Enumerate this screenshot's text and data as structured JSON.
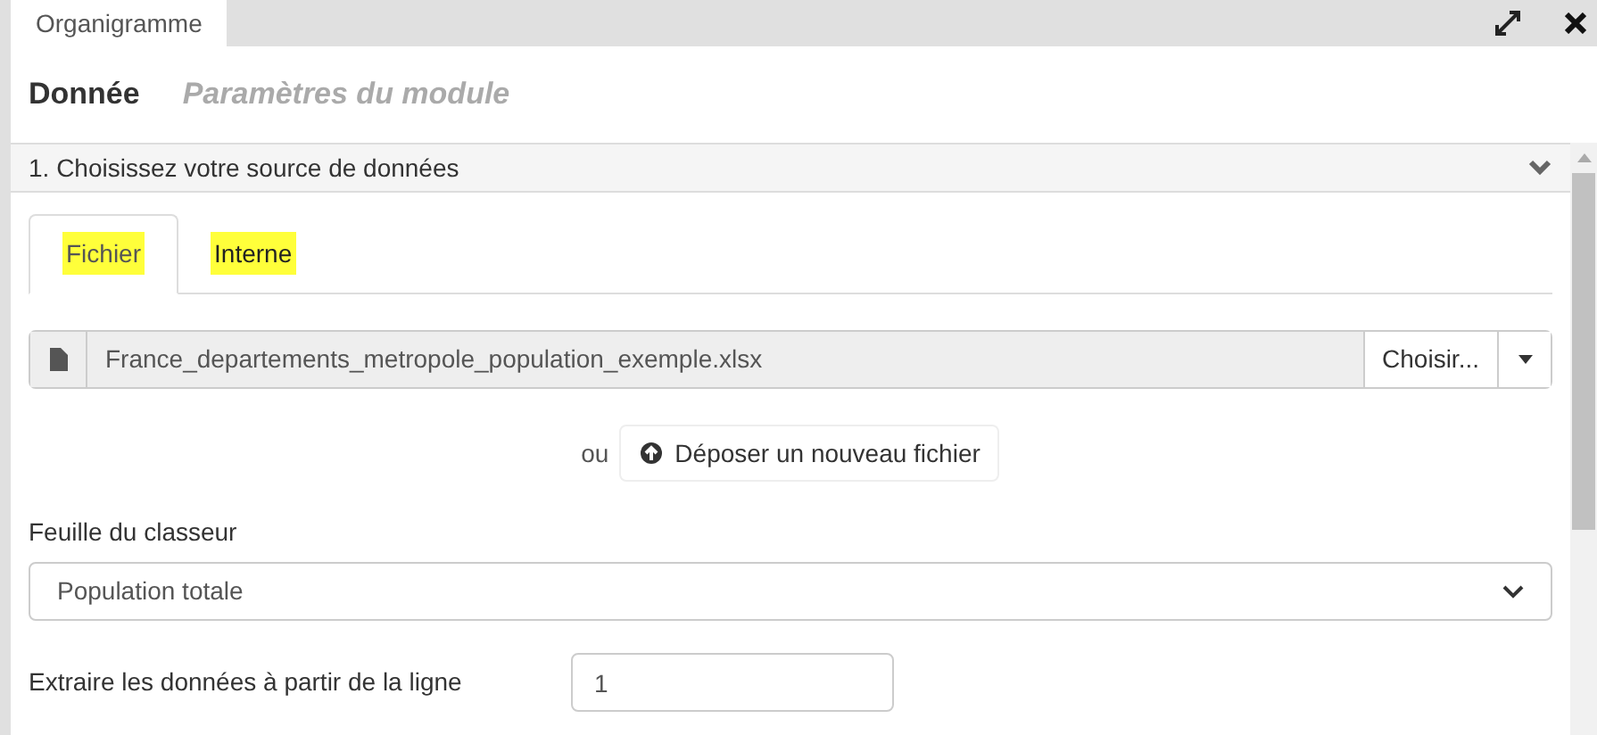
{
  "window": {
    "tab": "Organigramme"
  },
  "header_tabs": [
    {
      "label": "Donnée",
      "selected": true
    },
    {
      "label": "Paramètres du module",
      "selected": false
    }
  ],
  "section": {
    "title": "1. Choisissez votre source de données",
    "expanded": true
  },
  "source_tabs": [
    {
      "label": "Fichier",
      "selected": true
    },
    {
      "label": "Interne",
      "selected": false
    }
  ],
  "file": {
    "value": "France_departements_metropole_population_exemple.xlsx",
    "button": "Choisir..."
  },
  "or_text": "ou",
  "upload_button": "Déposer un nouveau fichier",
  "sheet": {
    "label": "Feuille du classeur",
    "value": "Population totale"
  },
  "start_line": {
    "label": "Extraire les données à partir de la ligne",
    "value": "1"
  }
}
